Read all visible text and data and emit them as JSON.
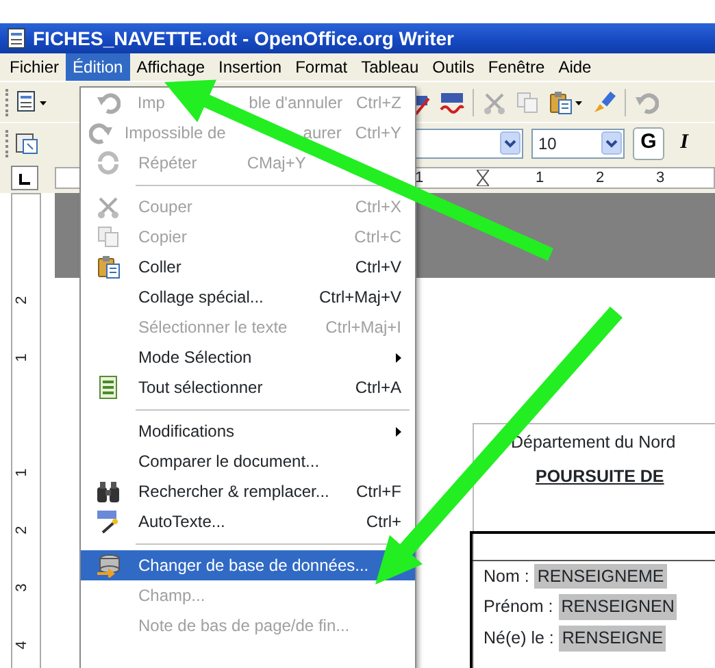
{
  "window": {
    "title": "FICHES_NAVETTE.odt - OpenOffice.org Writer"
  },
  "menu_bar": [
    {
      "label": "Fichier",
      "selected": false
    },
    {
      "label": "Édition",
      "selected": true
    },
    {
      "label": "Affichage",
      "selected": false
    },
    {
      "label": "Insertion",
      "selected": false
    },
    {
      "label": "Format",
      "selected": false
    },
    {
      "label": "Tableau",
      "selected": false
    },
    {
      "label": "Outils",
      "selected": false
    },
    {
      "label": "Fenêtre",
      "selected": false
    },
    {
      "label": "Aide",
      "selected": false
    }
  ],
  "formatting_toolbar": {
    "font_size": "10",
    "bold_button": "G",
    "italic_button": "I"
  },
  "ruler": {
    "labels": [
      "1",
      "1",
      "2",
      "3"
    ]
  },
  "vertical_ruler": {
    "labels": [
      "2",
      "1",
      "1",
      "2",
      "3",
      "4"
    ]
  },
  "edit_menu": {
    "items": [
      {
        "kind": "item",
        "label": [
          "Imp",
          "ble d'annuler"
        ],
        "shortcut": "Ctrl+Z",
        "disabled": true,
        "selected": false
      },
      {
        "kind": "item",
        "label": [
          "Impossible de",
          "aurer"
        ],
        "shortcut": "Ctrl+Y",
        "disabled": true,
        "selected": false
      },
      {
        "kind": "item",
        "label": "Répéter",
        "shortcut": [
          "C",
          "Maj+Y"
        ],
        "disabled": true,
        "selected": false
      },
      {
        "kind": "separator"
      },
      {
        "kind": "item",
        "label": "Couper",
        "shortcut": "Ctrl+X",
        "disabled": true,
        "selected": false
      },
      {
        "kind": "item",
        "label": "Copier",
        "shortcut": "Ctrl+C",
        "disabled": true,
        "selected": false
      },
      {
        "kind": "item",
        "label": "Coller",
        "shortcut": "Ctrl+V",
        "disabled": false,
        "selected": false
      },
      {
        "kind": "item",
        "label": "Collage spécial...",
        "shortcut": "Ctrl+Maj+V",
        "disabled": false,
        "selected": false
      },
      {
        "kind": "item",
        "label": "Sélectionner le texte",
        "shortcut": "Ctrl+Maj+I",
        "disabled": true,
        "selected": false
      },
      {
        "kind": "submenu",
        "label": "Mode Sélection",
        "disabled": false,
        "selected": false
      },
      {
        "kind": "item",
        "label": "Tout sélectionner",
        "shortcut": "Ctrl+A",
        "disabled": false,
        "selected": false
      },
      {
        "kind": "separator"
      },
      {
        "kind": "submenu",
        "label": "Modifications",
        "disabled": false,
        "selected": false
      },
      {
        "kind": "item",
        "label": "Comparer le document...",
        "disabled": false,
        "selected": false
      },
      {
        "kind": "item",
        "label": "Rechercher & remplacer...",
        "shortcut": "Ctrl+F",
        "disabled": false,
        "selected": false
      },
      {
        "kind": "item",
        "label": "AutoTexte...",
        "shortcut": "Ctrl+",
        "disabled": false,
        "selected": false
      },
      {
        "kind": "separator"
      },
      {
        "kind": "item",
        "label": "Changer de base de données...",
        "disabled": false,
        "selected": true
      },
      {
        "kind": "item",
        "label": "Champ...",
        "disabled": true,
        "selected": false
      },
      {
        "kind": "item",
        "label": "Note de bas de page/de fin...",
        "disabled": true,
        "selected": false
      }
    ]
  },
  "document": {
    "header": "Département du Nord",
    "heading": "POURSUITE DE",
    "fields": [
      {
        "label": "Nom :",
        "value": "RENSEIGNEME"
      },
      {
        "label": "Prénom :",
        "value": "RENSEIGNEN"
      },
      {
        "label": "Né(e) le :",
        "value": "RENSEIGNE"
      }
    ]
  }
}
